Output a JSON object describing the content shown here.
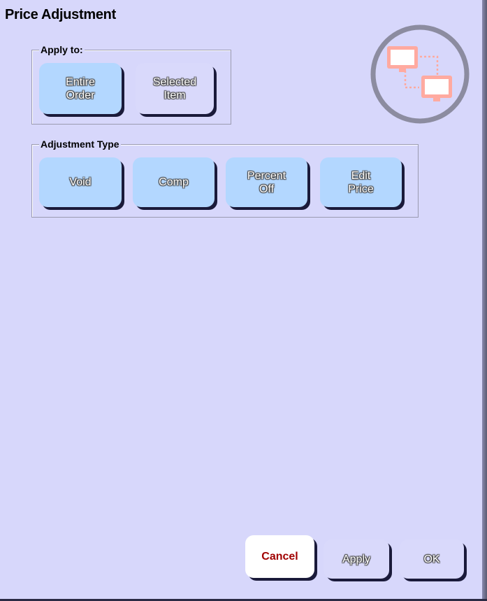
{
  "window": {
    "title": "Price Adjustment"
  },
  "apply_to": {
    "legend": "Apply to:",
    "buttons": [
      {
        "label": "Entire\nOrder",
        "selected": true
      },
      {
        "label": "Selected\nItem",
        "selected": false
      }
    ]
  },
  "adjustment_type": {
    "legend": "Adjustment Type",
    "buttons": [
      {
        "label": "Void"
      },
      {
        "label": "Comp"
      },
      {
        "label": "Percent\nOff"
      },
      {
        "label": "Edit\nPrice"
      }
    ]
  },
  "footer": {
    "cancel_label": "Cancel",
    "apply_label": "Apply",
    "ok_label": "OK"
  },
  "logo": {
    "icon": "network-computers-icon",
    "ring_color": "#8c8ca0",
    "monitor_color": "#ffaaa0"
  },
  "colors": {
    "background": "#d7d7fb",
    "button_blue": "#b3d7ff",
    "button_lavender": "#d9d9fb",
    "cancel_text": "#a00000"
  }
}
